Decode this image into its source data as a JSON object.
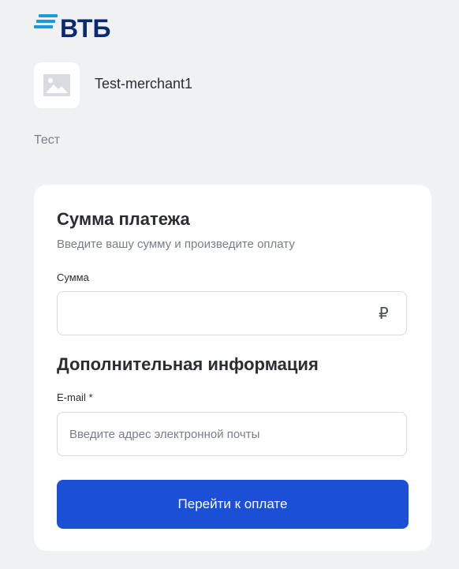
{
  "brand": {
    "name": "ВТБ",
    "color": "#0a2973",
    "accent": "#1a9be0"
  },
  "merchant": {
    "name": "Test-merchant1",
    "description": "Тест",
    "avatar_icon": "image-placeholder-icon"
  },
  "payment": {
    "title": "Сумма платежа",
    "subtitle": "Введите вашу сумму и произведите оплату",
    "amount_label": "Сумма",
    "amount_value": "",
    "currency_symbol": "₽"
  },
  "additional": {
    "title": "Дополнительная информация",
    "email_label": "E-mail *",
    "email_placeholder": "Введите адрес электронной почты",
    "email_value": ""
  },
  "submit": {
    "label": "Перейти к оплате",
    "color": "#1a4fd6"
  }
}
